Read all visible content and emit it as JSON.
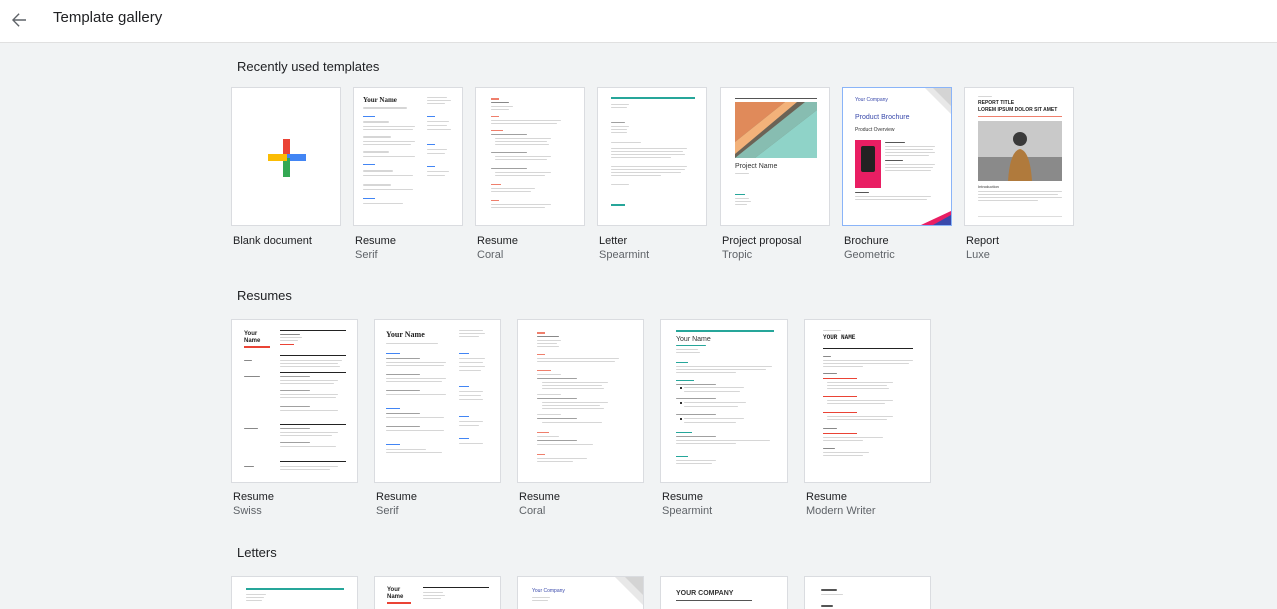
{
  "header": {
    "title": "Template gallery",
    "back_icon": "arrow-back-icon"
  },
  "sections": {
    "recent": {
      "title": "Recently used templates",
      "items": [
        {
          "name": "Blank document",
          "sub": ""
        },
        {
          "name": "Resume",
          "sub": "Serif"
        },
        {
          "name": "Resume",
          "sub": "Coral"
        },
        {
          "name": "Letter",
          "sub": "Spearmint"
        },
        {
          "name": "Project proposal",
          "sub": "Tropic"
        },
        {
          "name": "Brochure",
          "sub": "Geometric"
        },
        {
          "name": "Report",
          "sub": "Luxe"
        }
      ]
    },
    "resumes": {
      "title": "Resumes",
      "items": [
        {
          "name": "Resume",
          "sub": "Swiss"
        },
        {
          "name": "Resume",
          "sub": "Serif"
        },
        {
          "name": "Resume",
          "sub": "Coral"
        },
        {
          "name": "Resume",
          "sub": "Spearmint"
        },
        {
          "name": "Resume",
          "sub": "Modern Writer"
        }
      ]
    },
    "letters": {
      "title": "Letters"
    }
  },
  "thumb_text": {
    "your_name": "Your Name",
    "project_name": "Project Name",
    "your_company": "Your Company",
    "product_brochure": "Product Brochure",
    "product_overview": "Product Overview",
    "report_title": "REPORT TITLE",
    "report_sub": "LOREM IPSUM DOLOR SIT AMET",
    "introduction": "Introduction",
    "your_name_caps": "YOUR NAME",
    "your_company_caps": "YOUR COMPANY",
    "swiss_name_1": "Your",
    "swiss_name_2": "Name"
  },
  "colors": {
    "accent_blue": "#4285f4",
    "red": "#ea4335",
    "yellow": "#fbbc04",
    "green": "#34a853",
    "spearmint": "#26a69a",
    "coral": "#ef7f6c",
    "brochure_pink": "#e91e63",
    "brochure_blue": "#3949ab"
  }
}
